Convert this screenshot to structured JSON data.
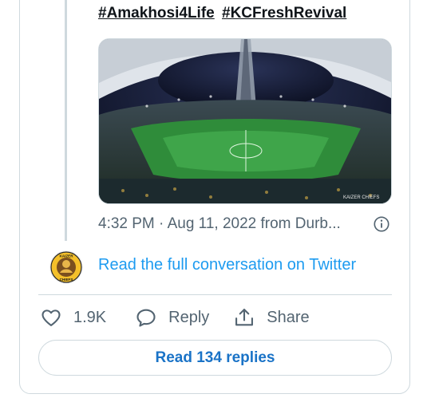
{
  "tweet": {
    "hashtags": [
      "#Amakhosi4Life",
      "#KCFreshRevival"
    ],
    "timestamp": "4:32 PM · Aug 11, 2022 from Durb...",
    "read_conversation": "Read the full conversation on Twitter",
    "watermark": "KAIZER CHIEFS"
  },
  "actions": {
    "like_count": "1.9K",
    "reply_label": "Reply",
    "share_label": "Share"
  },
  "replies_button": "Read 134 replies",
  "avatar_logo_text": "KAIZER CHIEFS",
  "colors": {
    "link_blue": "#1d9bf0",
    "button_blue": "#1a73c7",
    "muted": "#536471",
    "border": "#cfd9de"
  }
}
